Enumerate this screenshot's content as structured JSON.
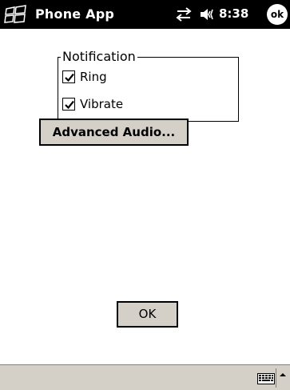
{
  "titlebar": {
    "app_title": "Phone App",
    "time": "8:38",
    "ok_label": "ok",
    "icons": [
      "windows-start-icon",
      "sync-icon",
      "speaker-icon"
    ]
  },
  "notification": {
    "group_label": "Notification",
    "options": [
      {
        "label": "Ring",
        "checked": true
      },
      {
        "label": "Vibrate",
        "checked": true
      }
    ]
  },
  "buttons": {
    "advanced_audio": "Advanced Audio...",
    "ok": "OK"
  },
  "menubar": {
    "icons": [
      "keyboard-icon",
      "input-menu-arrow-icon"
    ]
  }
}
